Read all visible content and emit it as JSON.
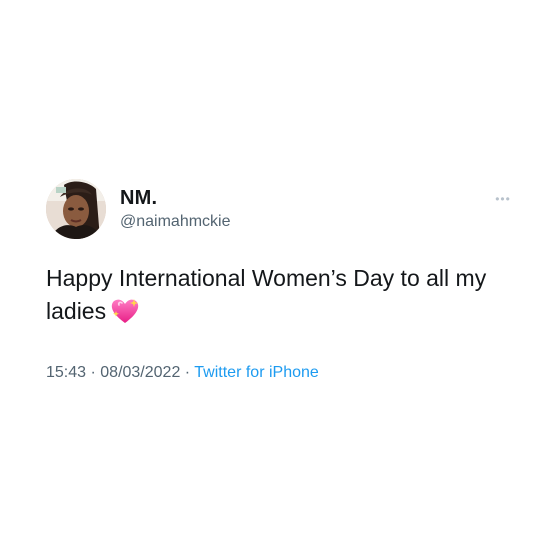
{
  "user": {
    "display_name": "NM.",
    "handle": "@naimahmckie"
  },
  "tweet": {
    "text": "Happy International Women’s Day to all my ladies",
    "emoji_icon": "sparkling-heart-icon"
  },
  "meta": {
    "time": "15:43",
    "separator_1": " · ",
    "date": "08/03/2022",
    "separator_2": " · ",
    "source": "Twitter for iPhone"
  },
  "more_menu": {
    "label": "•••",
    "icon": "more-options-icon"
  },
  "colors": {
    "text": "#14171a",
    "secondary": "#536471",
    "link": "#1d9bf0",
    "heart": "#ff4fa3"
  }
}
